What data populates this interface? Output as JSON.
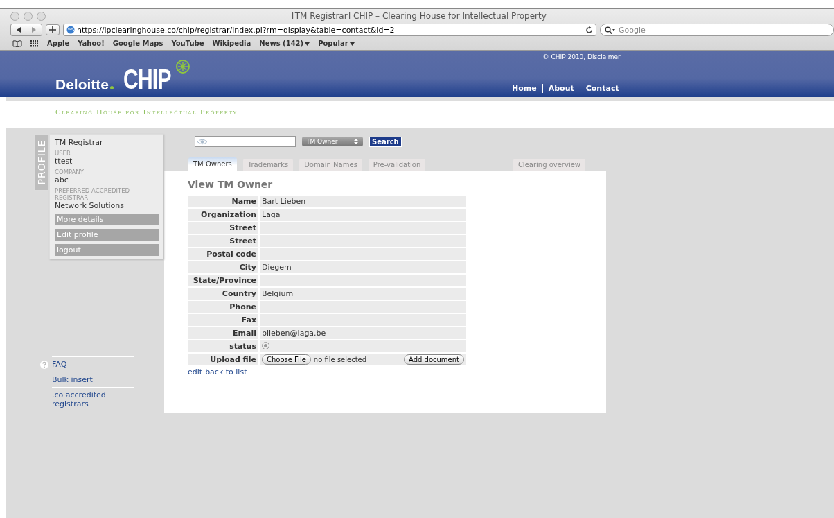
{
  "window": {
    "title": "[TM Registrar] CHIP – Clearing House for Intellectual Property"
  },
  "toolbar": {
    "url": "https://ipclearinghouse.co/chip/registrar/index.pl?rm=display&table=contact&id=2",
    "search_placeholder": "Google"
  },
  "bookmarks": [
    {
      "label": "Apple",
      "menu": false
    },
    {
      "label": "Yahoo!",
      "menu": false
    },
    {
      "label": "Google Maps",
      "menu": false
    },
    {
      "label": "YouTube",
      "menu": false
    },
    {
      "label": "Wikipedia",
      "menu": false
    },
    {
      "label": "News (142)",
      "menu": true
    },
    {
      "label": "Popular",
      "menu": true
    }
  ],
  "header": {
    "brand": "Deloitte",
    "logo": "CHIP",
    "copyright": "© CHIP 2010, Disclaimer",
    "nav": [
      "Home",
      "About",
      "Contact"
    ],
    "tagline": "Clearing House for Intellectual Property"
  },
  "profile": {
    "tab_label": "PROFILE",
    "role": "TM Registrar",
    "fields": [
      {
        "label": "USER",
        "value": "ttest"
      },
      {
        "label": "COMPANY",
        "value": "abc"
      },
      {
        "label": "PREFERRED ACCREDITED REGISTRAR",
        "value": "Network Solutions"
      }
    ],
    "buttons": [
      "More details",
      "Edit profile",
      "logout"
    ]
  },
  "side_links": [
    "FAQ",
    "Bulk insert",
    ".co accredited registrars"
  ],
  "search": {
    "type": "TM Owner",
    "button": "Search"
  },
  "tabs": [
    {
      "label": "TM Owners",
      "selected": true
    },
    {
      "label": "Trademarks",
      "selected": false
    },
    {
      "label": "Domain Names",
      "selected": false
    },
    {
      "label": "Pre-validation",
      "selected": false
    }
  ],
  "overview_tab": "Clearing overview",
  "heading": "View TM Owner",
  "rows": [
    {
      "label": "Name",
      "value": "Bart Lieben"
    },
    {
      "label": "Organization",
      "value": "Laga"
    },
    {
      "label": "Street"
    },
    {
      "label": "Street"
    },
    {
      "label": "Postal code"
    },
    {
      "label": "City",
      "value": "Diegem"
    },
    {
      "label": "State/Province"
    },
    {
      "label": "Country",
      "value": "Belgium"
    },
    {
      "label": "Phone"
    },
    {
      "label": "Fax"
    },
    {
      "label": "Email",
      "value": "blieben@laga.be"
    }
  ],
  "status_label": "status",
  "upload": {
    "label": "Upload file",
    "choose": "Choose File",
    "file": "no file selected",
    "add": "Add document"
  },
  "links": [
    "edit",
    "back to list"
  ]
}
